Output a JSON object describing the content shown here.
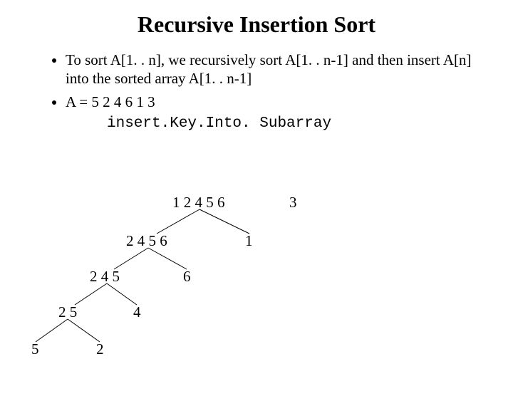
{
  "title": "Recursive Insertion Sort",
  "bullets": {
    "b1": "To sort A[1. . n], we recursively sort A[1. . n-1] and then insert A[n] into the sorted array A[1. . n-1]",
    "b2": "A = 5 2 4 6 1 3"
  },
  "code": "insert.Key.Into. Subarray",
  "tree": {
    "n0_left": "1 2 4 5 6",
    "n0_right": "3",
    "n1_left": "2 4 5 6",
    "n1_right": "1",
    "n2_left": "2 4 5",
    "n2_right": "6",
    "n3_left": "2 5",
    "n3_right": "4",
    "n4_left": "5",
    "n4_right": "2"
  }
}
